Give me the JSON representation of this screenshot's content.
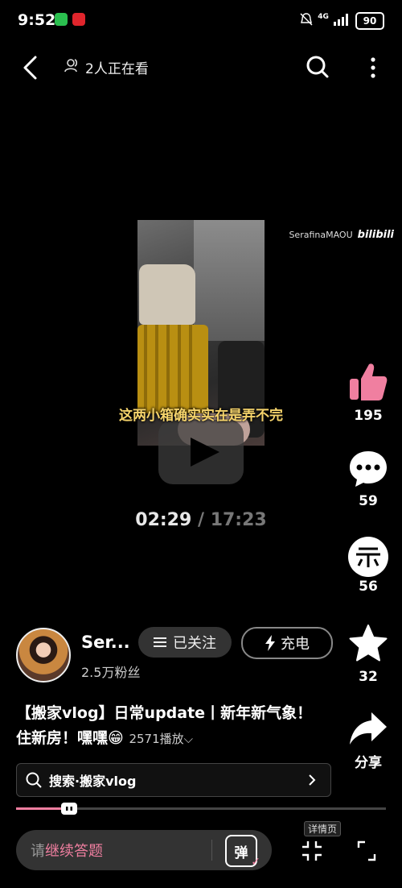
{
  "status_bar": {
    "time": "9:52",
    "network": "4G",
    "battery": "90"
  },
  "top_bar": {
    "viewers_label": "2人正在看"
  },
  "video": {
    "subtitle": "这两小箱确实实在是弄不完",
    "watermark_user": "SerafinaMAOU",
    "watermark_brand": "bilibili",
    "current_time": "02:29",
    "separator": "/",
    "duration": "17:23"
  },
  "actions": {
    "like_count": "195",
    "comment_count": "59",
    "coin_count": "56",
    "favorite_count": "32",
    "share_label": "分享"
  },
  "uploader": {
    "name": "Ser...",
    "fans": "2.5万粉丝",
    "follow_label": "已关注",
    "charge_label": "充电"
  },
  "video_info": {
    "title": "【搬家vlog】日常update丨新年新气象！住新房！嘿嘿😁",
    "plays": "2571播放"
  },
  "search": {
    "label": "搜索·搬家vlog"
  },
  "progress": {
    "fraction": 0.143
  },
  "bottom_bar": {
    "danmaku_prefix": "请",
    "danmaku_highlight": "继续答题",
    "danmaku_button": "弹",
    "details_label": "详情页"
  },
  "colors": {
    "accent_pink": "#f07fa0",
    "background": "#000000"
  },
  "icons": [
    "back-icon",
    "viewers-icon",
    "search-icon",
    "more-icon",
    "play-icon",
    "like-icon",
    "comment-icon",
    "coin-icon",
    "favorite-icon",
    "share-icon",
    "menu-icon",
    "bolt-icon",
    "chevron-right-icon",
    "shrink-icon",
    "fullscreen-icon"
  ]
}
